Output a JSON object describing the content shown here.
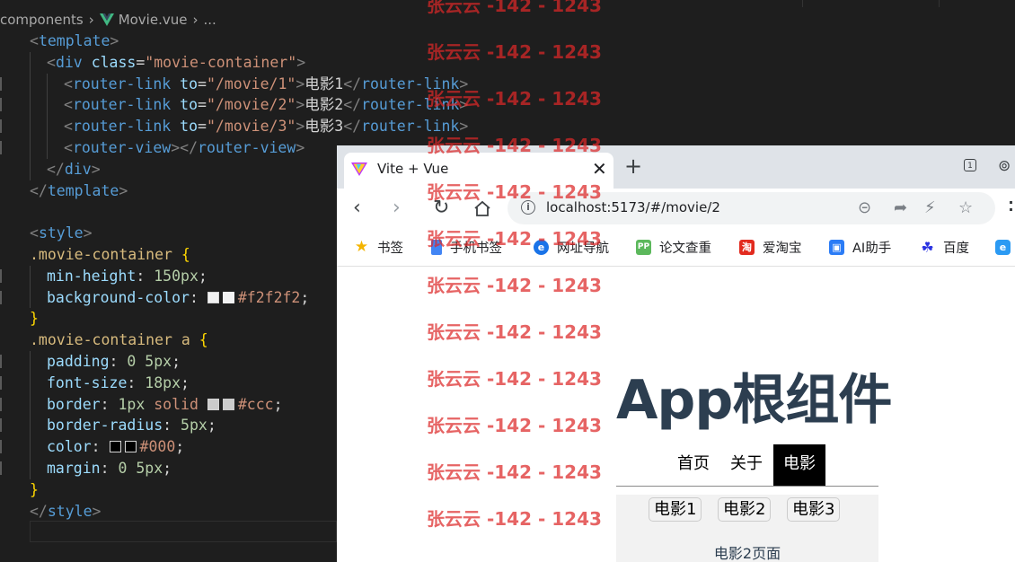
{
  "editor": {
    "breadcrumb": {
      "folder": "components",
      "file": "Movie.vue",
      "more": "..."
    },
    "lines": [
      "<template>",
      "<div class=\"movie-container\">",
      "<router-link to=\"/movie/1\">电影1</router-link>",
      "<router-link to=\"/movie/2\">电影2</router-link>",
      "<router-link to=\"/movie/3\">电影3</router-link>",
      "<router-view></router-view>",
      "</div>",
      "</template>",
      "",
      "<style>",
      ".movie-container {",
      "min-height: 150px;",
      "background-color: #f2f2f2;",
      "}",
      ".movie-container a {",
      "padding: 0 5px;",
      "font-size: 18px;",
      "border: 1px solid #ccc;",
      "border-radius: 5px;",
      "color: #000;",
      "margin: 0 5px;",
      "}",
      "</style>"
    ]
  },
  "browser": {
    "tab_title": "Vite + Vue",
    "url": "localhost:5173/#/movie/2",
    "window_counter": "1",
    "bookmarks": [
      "书签",
      "手机书签",
      "网址导航",
      "论文查重",
      "爱淘宝",
      "AI助手",
      "百度"
    ],
    "app": {
      "title": "App根组件",
      "nav": [
        "首页",
        "关于",
        "电影"
      ],
      "active_nav": "电影",
      "movie_links": [
        "电影1",
        "电影2",
        "电影3"
      ],
      "movie_page": "电影2页面"
    }
  },
  "watermark": "张云云 -142 - 1243",
  "colors": {
    "editor_bg": "#1e1e1e",
    "app_title": "#2c3e50",
    "movie_container_bg": "#f2f2f2",
    "movie_link_border": "#cccccc",
    "watermark": "#dc2828"
  }
}
